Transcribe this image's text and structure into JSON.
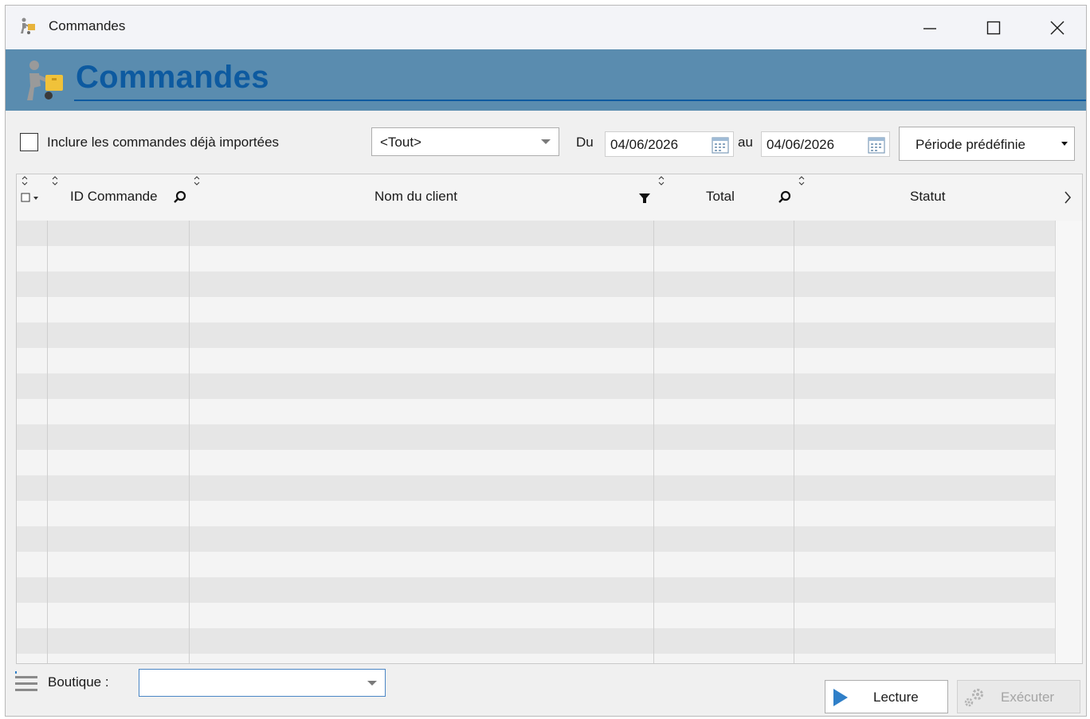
{
  "window": {
    "title": "Commandes",
    "app_icon": "delivery-person-icon",
    "controls": [
      "minimize-icon",
      "maximize-icon",
      "close-icon"
    ]
  },
  "banner": {
    "title": "Commandes",
    "icon": "delivery-person-icon",
    "background": "#5a8caf",
    "title_color": "#0d5aa0"
  },
  "filters": {
    "include_imported_label": "Inclure les commandes déjà importées",
    "include_imported_checked": false,
    "type_value": "<Tout>",
    "from_label": "Du",
    "from_date": "04/06/2026",
    "to_label": "au",
    "to_date": "04/06/2026",
    "period_label": "Période prédéfinie"
  },
  "table": {
    "columns": [
      {
        "label": "",
        "icon": "select-checkbox-icon"
      },
      {
        "label": "ID Commande",
        "icon": "search-icon"
      },
      {
        "label": "Nom du client",
        "icon": "filter-icon"
      },
      {
        "label": "Total",
        "icon": "search-icon"
      },
      {
        "label": "Statut",
        "icon": "chevron-right-icon"
      }
    ],
    "rows": []
  },
  "bottom": {
    "boutique_label": "Boutique :",
    "boutique_value": "",
    "lecture_label": "Lecture",
    "executer_label": "Exécuter",
    "executer_enabled": false
  }
}
